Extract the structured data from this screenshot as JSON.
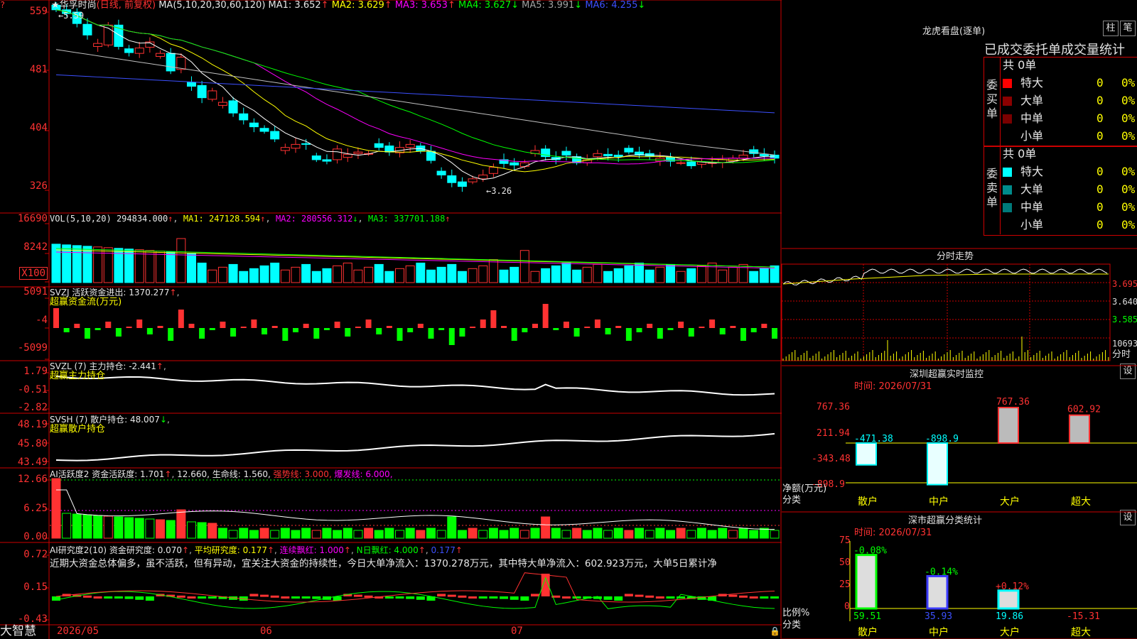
{
  "colors": {
    "up": "#ff3232",
    "down": "#00ffff",
    "frame": "#cc0000",
    "ma1": "#ffffff",
    "ma2": "#ffff00",
    "ma3": "#ff00ff",
    "ma4": "#00ff00",
    "ma5": "#c0c0c0",
    "ma6": "#3c50ff"
  },
  "kline": {
    "title": "★华孚时尚",
    "mode": "(日线, 前复权)",
    "ma_label": "MA(5,10,20,30,60,120)",
    "ma": [
      {
        "k": "MA1: 3.652",
        "a": "↑"
      },
      {
        "k": "MA2: 3.629",
        "a": "↑"
      },
      {
        "k": "MA3: 3.653",
        "a": "↑"
      },
      {
        "k": "MA4: 3.627",
        "a": "↓"
      },
      {
        "k": "MA5: 3.991",
        "a": "↓"
      },
      {
        "k": "MA6: 4.255",
        "a": "↓"
      }
    ],
    "yticks": [
      "559",
      "481",
      "404",
      "326"
    ],
    "high_mark": "5.59",
    "low_mark": "3.26",
    "closes": [
      5.62,
      5.57,
      5.44,
      5.29,
      5.18,
      5.42,
      5.14,
      5.06,
      5.12,
      5.2,
      5.05,
      4.82,
      5.0,
      4.62,
      4.47,
      4.56,
      4.41,
      4.27,
      4.18,
      4.09,
      4.03,
      3.93,
      3.82,
      3.86,
      3.86,
      3.66,
      3.64,
      3.8,
      3.73,
      3.76,
      3.74,
      3.82,
      3.76,
      3.82,
      3.86,
      3.77,
      3.65,
      3.46,
      3.36,
      3.31,
      3.41,
      3.46,
      3.56,
      3.61,
      3.59,
      3.62,
      3.78,
      3.7,
      3.66,
      3.72,
      3.62,
      3.66,
      3.74,
      3.71,
      3.7,
      3.76,
      3.72,
      3.71,
      3.68,
      3.64,
      3.62,
      3.58,
      3.63,
      3.62,
      3.66,
      3.68,
      3.72,
      3.74,
      3.71,
      3.68
    ]
  },
  "vol": {
    "label": "VOL(5,10,20)",
    "v": "294834.000",
    "ma": [
      {
        "k": "MA1: 247128.594",
        "a": "↑"
      },
      {
        "k": "MA2: 280556.312",
        "a": "↓"
      },
      {
        "k": "MA3: 337701.188",
        "a": "↑"
      }
    ],
    "yticks": [
      "16690",
      "8242",
      "X100"
    ]
  },
  "svzj": {
    "label": "SVZJ  活跃资金进出: 1370.277",
    "arrow": "↑",
    "sub": "超赢资金流(万元)",
    "yticks": [
      "5091",
      "-4",
      "-5099"
    ]
  },
  "svzl": {
    "label": "SVZL (7) 主力持仓: -2.441",
    "arrow": "↑",
    "sub": "超赢主力持仓",
    "yticks": [
      "1.79",
      "-0.51",
      "-2.82"
    ]
  },
  "svsh": {
    "label": "SVSH (7) 散户持仓: 48.007",
    "arrow": "↓",
    "sub": "超赢散户持仓",
    "yticks": [
      "48.19",
      "45.80",
      "43.49"
    ]
  },
  "ai1": {
    "p1": "AI活跃度2 资金活跃度: 1.701",
    "p2": "12.660,",
    "p3": "生命线: 1.560,",
    "p4": "强势线: 3.000,",
    "p5": "爆发线: 6.000,",
    "yticks": [
      "12.66",
      "6.25",
      "0.00"
    ]
  },
  "ai2": {
    "p1": "AI研究度2(10) 资金研究度: 0.070",
    "p2": "平均研究度: 0.177",
    "p3": "连续飘红: 1.000",
    "p4": "N日飘红: 4.000",
    "p5": "0.177",
    "note": "近期大资金总体偏多，虽不活跃，但有异动，宜关注大资金的持续性，今日大单净流入：1370.278万元，其中特大单净流入：602.923万元，大单5日累计净",
    "yticks": [
      "0.72",
      "0.15",
      "-0.43"
    ]
  },
  "xaxis": {
    "labels": [
      "2026/05",
      "06",
      "07"
    ]
  },
  "brand": "大智慧",
  "longhu": {
    "title": "龙虎看盘(逐单)",
    "btn1": "柱",
    "btn2": "笔",
    "subtitle": "已成交委托单成交量统计",
    "buy": {
      "side": "委买单",
      "total": "共 0单",
      "rows": [
        {
          "n": "特大",
          "v": "0",
          "p": "0%",
          "c": "#ff0000"
        },
        {
          "n": "大单",
          "v": "0",
          "p": "0%",
          "c": "#8b0000"
        },
        {
          "n": "中单",
          "v": "0",
          "p": "0%",
          "c": "#7a0000"
        },
        {
          "n": "小单",
          "v": "0",
          "p": "0%",
          "c": "#000000"
        }
      ]
    },
    "sell": {
      "side": "委卖单",
      "total": "共 0单",
      "rows": [
        {
          "n": "特大",
          "v": "0",
          "p": "0%",
          "c": "#00ffff"
        },
        {
          "n": "大单",
          "v": "0",
          "p": "0%",
          "c": "#008b8b"
        },
        {
          "n": "中单",
          "v": "0",
          "p": "0%",
          "c": "#007a7a"
        },
        {
          "n": "小单",
          "v": "0",
          "p": "0%",
          "c": "#000000"
        }
      ]
    }
  },
  "fenshi": {
    "title": "分时走势",
    "yticks": [
      "3.695",
      "3.640",
      "3.585",
      "10693",
      "分时"
    ]
  },
  "sz": {
    "title": "深圳超赢实时监控",
    "btn": "设",
    "time": "时间: 2026/07/31",
    "yticks": [
      "767.36",
      "211.94",
      "-343.48",
      "-898.9"
    ],
    "ylabel1": "净额(万元)",
    "ylabel2": "分类",
    "cats": [
      "散户",
      "中户",
      "大户",
      "超大"
    ],
    "values": [
      -471.38,
      -898.9,
      767.36,
      602.92
    ],
    "labels": [
      "-471.38",
      "-898.9",
      "767.36",
      "602.92"
    ]
  },
  "sc": {
    "title": "深市超赢分类统计",
    "btn": "设",
    "time": "时间: 2026/07/31",
    "yticks": [
      "75",
      "50",
      "25",
      "0"
    ],
    "ylabel1": "比例%",
    "ylabel2": "分类",
    "cats": [
      "散户",
      "中户",
      "大户",
      "超大"
    ],
    "values": [
      59.51,
      35.93,
      19.86,
      -15.31
    ],
    "bottom": [
      "59.51",
      "35.93",
      "19.86",
      "-15.31"
    ],
    "top": [
      "-0.08%",
      "-0.14%",
      "+0.12%",
      ""
    ]
  }
}
